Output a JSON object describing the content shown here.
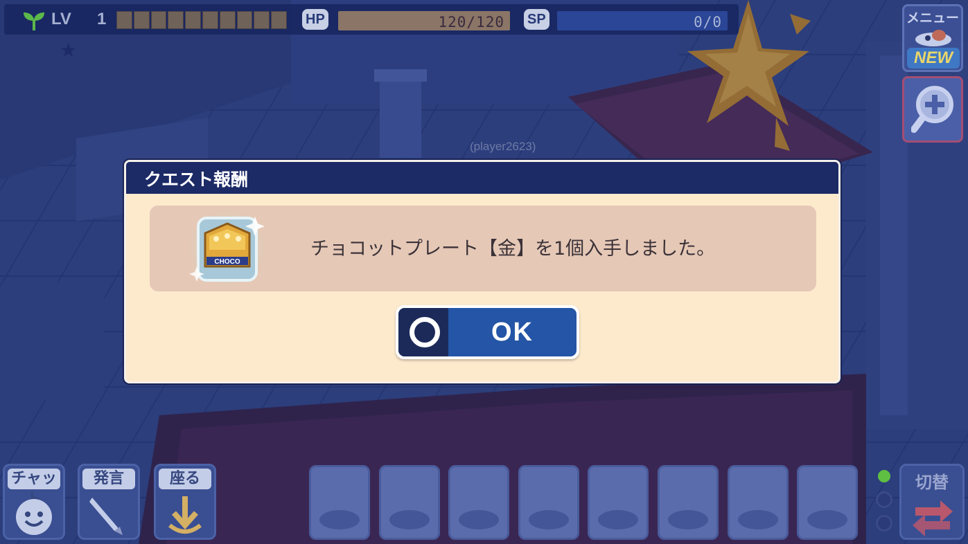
{
  "hud": {
    "level_label": "LV",
    "level_value": "1",
    "exp_segments": 10,
    "hp_label": "HP",
    "hp_text": "120/120",
    "hp_fraction": 1.0,
    "sp_label": "SP",
    "sp_text": "0/0",
    "sp_fraction": 0.0
  },
  "menu": {
    "label": "メニュー",
    "new_badge": "NEW"
  },
  "player": {
    "name": "(player2623)"
  },
  "dialog": {
    "title": "クエスト報酬",
    "item_icon_text": "CHOCO",
    "message": "チョコットプレート【金】を1個入手しました。",
    "ok_label": "OK"
  },
  "bottom": {
    "chat_label": "チャット",
    "say_label": "発言",
    "sit_label": "座る",
    "switch_label": "切替",
    "slot_count": 8,
    "indicators": [
      true,
      false,
      false
    ]
  },
  "colors": {
    "dialog_bg": "#fdeacd",
    "dialog_title_bg": "#1c2a66",
    "reward_panel": "#e5c8b6",
    "ok_button": "#2455a6",
    "scene_blue": "#2c3f7e",
    "indicator_on": "#5fbf43"
  }
}
